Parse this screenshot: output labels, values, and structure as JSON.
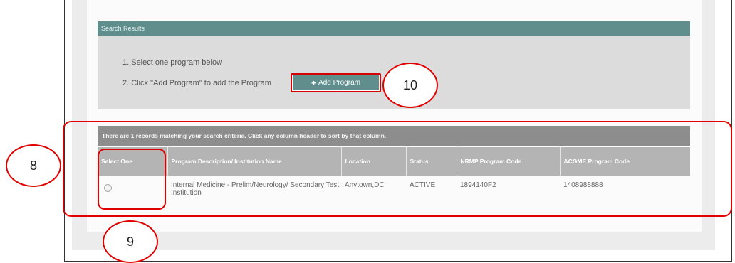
{
  "search_results": {
    "header": "Search Results",
    "instructions": {
      "step1": "1. Select one program below",
      "step2": "2. Click \"Add Program\" to add the Program"
    },
    "add_button": {
      "icon": "plus-icon",
      "label": "Add Program"
    },
    "criteria_message": "There are 1 records matching your search criteria. Click any column header to sort by that column.",
    "table": {
      "columns": [
        "Select One",
        "Program Description/ Institution Name",
        "Location",
        "Status",
        "NRMP Program Code",
        "ACGME Program Code"
      ],
      "rows": [
        {
          "description": "Internal Medicine - Prelim/Neurology/ Secondary Test Institution",
          "location": "Anytown,DC",
          "status": "ACTIVE",
          "nrmp_code": "1894140F2",
          "acgme_code": "1408988888"
        }
      ]
    }
  },
  "annotations": {
    "callout_8": "8",
    "callout_9": "9",
    "callout_10": "10",
    "color": "#e00000"
  }
}
